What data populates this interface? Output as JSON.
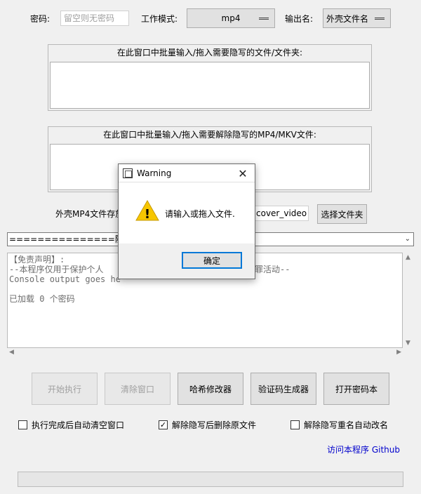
{
  "top_row": {
    "password_label": "密码:",
    "password_placeholder": "留空则无密码",
    "mode_label": "工作模式:",
    "mode_value": "mp4",
    "output_label": "输出名:",
    "output_value": "外壳文件名"
  },
  "panels": {
    "hide_title": "在此窗口中批量输入/拖入需要隐写的文件/文件夹:",
    "unhide_title": "在此窗口中批量输入/拖入需要解除隐写的MP4/MKV文件:"
  },
  "cover": {
    "label": "外壳MP4文件存放",
    "folder_value": "cover_video",
    "select_button": "选择文件夹"
  },
  "combo": {
    "value": "===============随机选择"
  },
  "console": {
    "lines": [
      "【免责声明】:",
      "--本程序仅用于保护个人",
      "Console output goes he",
      "",
      "已加载 0 个密码"
    ],
    "line2_tail": "罪活动--"
  },
  "buttons": {
    "start": "开始执行",
    "clear": "清除窗口",
    "hash": "哈希修改器",
    "captcha": "验证码生成器",
    "open_pw": "打开密码本"
  },
  "options": {
    "auto_clear": "执行完成后自动清空窗口",
    "delete_original": "解除隐写后删除原文件",
    "auto_rename": "解除隐写重名自动改名",
    "auto_clear_checked": false,
    "delete_original_checked": true,
    "auto_rename_checked": false,
    "check_mark": "✓"
  },
  "github_link": "访问本程序 Github",
  "dialog": {
    "title": "Warning",
    "close_glyph": "✕",
    "message": "请输入或拖入文件.",
    "ok": "确定",
    "warning_glyph": "!"
  },
  "colors": {
    "accent": "#0078d7",
    "link": "#0000cc",
    "warning_yellow": "#f7c600"
  }
}
